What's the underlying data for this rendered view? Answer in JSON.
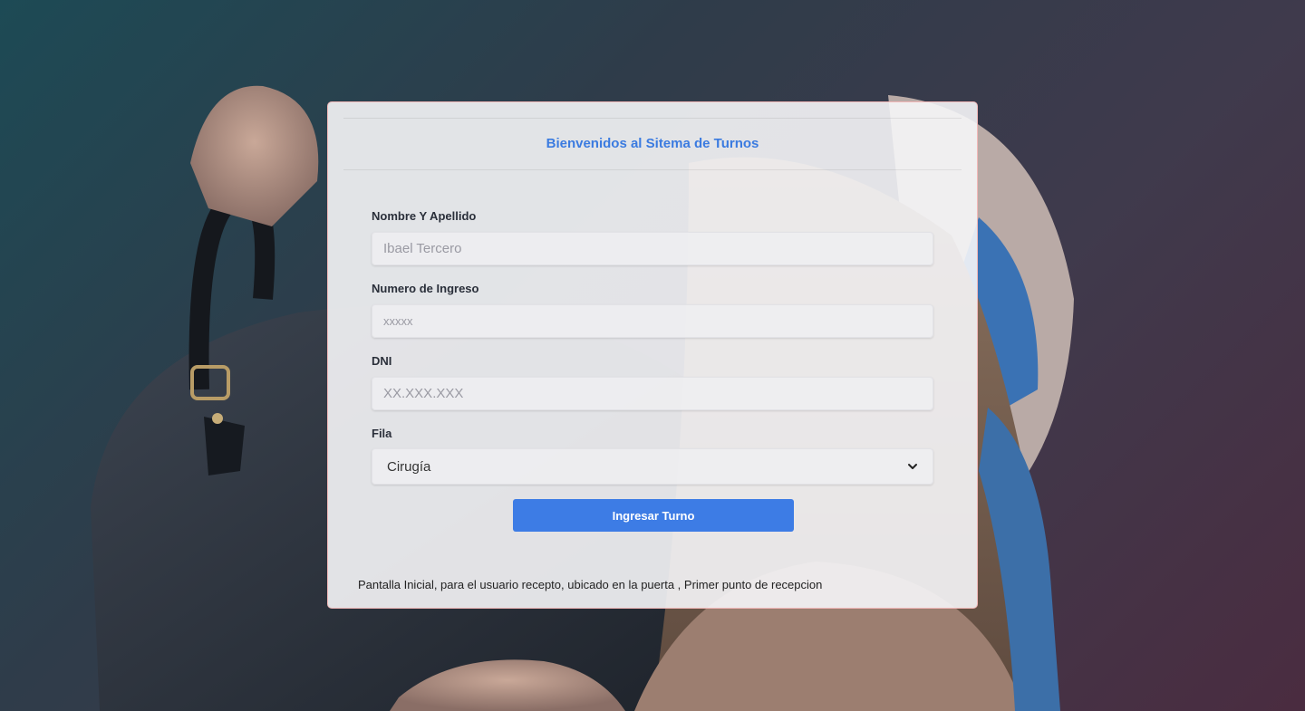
{
  "background": {
    "description_icon": "woman-with-dog-in-handbag-photo",
    "colors": {
      "teal": "#1d4a55",
      "slate": "#3f3a4c",
      "plum": "#4a2c40"
    }
  },
  "form": {
    "title": "Bienvenidos al Sitema de Turnos",
    "accent_color": "#3b7be0",
    "name": {
      "label": "Nombre Y Apellido",
      "placeholder": "Ibael Tercero",
      "value": ""
    },
    "entry_number": {
      "label": "Numero de Ingreso",
      "placeholder": "xxxxx",
      "value": ""
    },
    "dni": {
      "label": "DNI",
      "placeholder": "XX.XXX.XXX",
      "value": ""
    },
    "queue": {
      "label": "Fila",
      "selected": "Cirugía"
    },
    "submit_label": "Ingresar Turno",
    "footer_text": "Pantalla Inicial, para el usuario recepto, ubicado en la puerta , Primer punto de recepcion"
  }
}
